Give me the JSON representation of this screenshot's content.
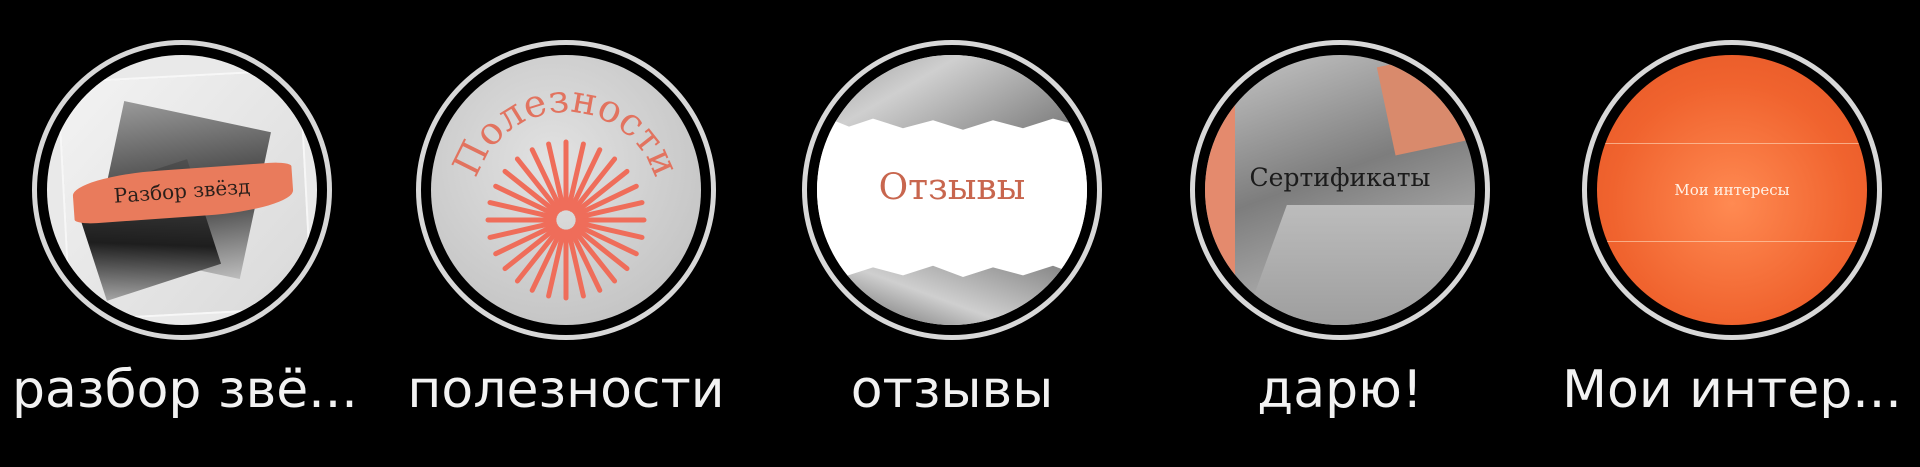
{
  "highlights": [
    {
      "label": "разбор звё...",
      "cover_text": "Разбор звёзд"
    },
    {
      "label": "полезности",
      "cover_text": "Полезности"
    },
    {
      "label": "отзывы",
      "cover_text": "Отзывы"
    },
    {
      "label": "дарю!",
      "cover_text": "Сертификаты"
    },
    {
      "label": "Мои интер...",
      "cover_text": "Мои интересы"
    }
  ],
  "colors": {
    "background": "#000000",
    "ring": "#d8d8d8",
    "label": "#f2f2f2",
    "accent_coral": "#e97b5c",
    "accent_orange": "#f0632e"
  }
}
